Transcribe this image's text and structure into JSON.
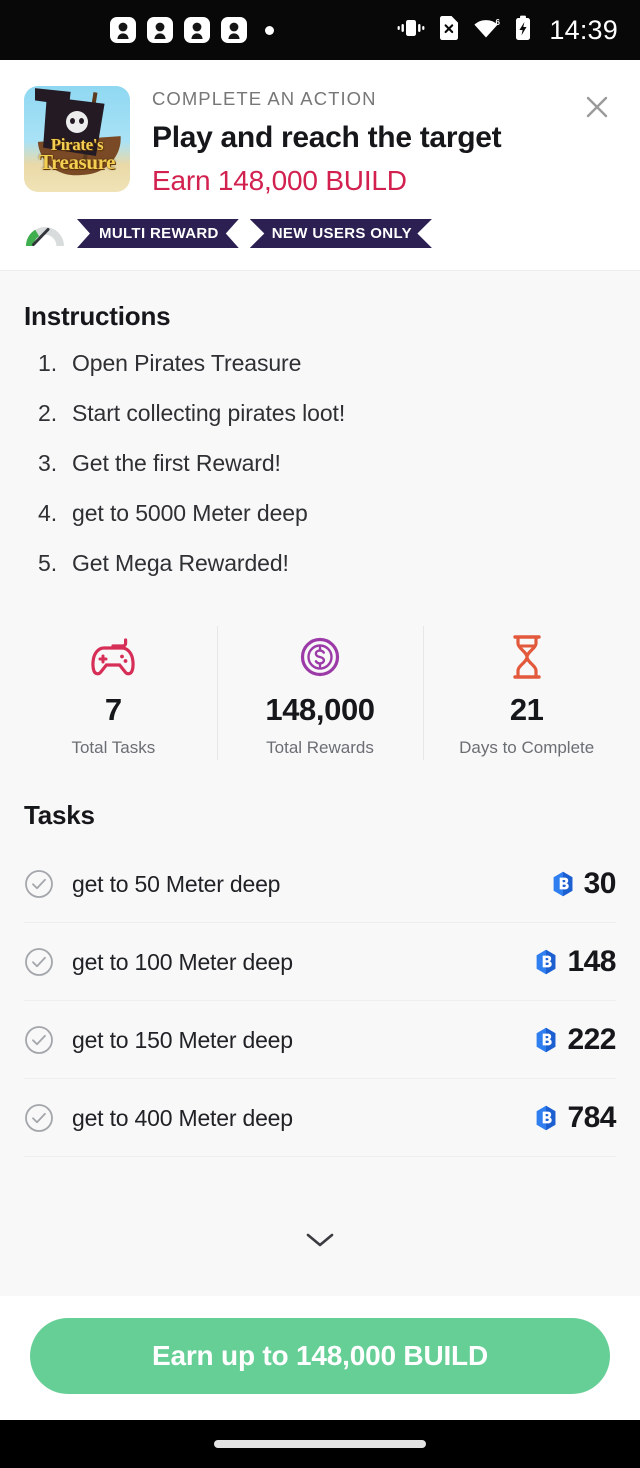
{
  "status_bar": {
    "time": "14:39",
    "notification_count": 4,
    "icons": [
      "notification-icon",
      "notification-icon",
      "notification-icon",
      "notification-icon",
      "notification-dot",
      "vibrate-icon",
      "no-sim-icon",
      "wifi-icon",
      "battery-charging-icon"
    ],
    "wifi_label": "6"
  },
  "offer": {
    "kicker": "COMPLETE AN ACTION",
    "title": "Play and reach the target",
    "reward_text": "Earn 148,000 BUILD",
    "reward_color": "#d2204f",
    "app_icon_title_line1": "Pirate's",
    "app_icon_title_line2": "Treasure",
    "close_label": "✕",
    "badges": [
      {
        "label": "MULTI REWARD"
      },
      {
        "label": "NEW USERS ONLY"
      }
    ],
    "difficulty_icon": "gauge-icon",
    "badge_color": "#2c1f51"
  },
  "instructions": {
    "heading": "Instructions",
    "steps": [
      "Open Pirates Treasure",
      "Start collecting pirates loot!",
      "Get the first Reward!",
      "get to 5000 Meter deep",
      "Get Mega Rewarded!"
    ]
  },
  "stats": [
    {
      "icon": "gamepad-icon",
      "value": "7",
      "label": "Total Tasks",
      "color": "#d62e56"
    },
    {
      "icon": "dollar-coin-icon",
      "value": "148,000",
      "label": "Total Rewards",
      "color": "#9c3ba8"
    },
    {
      "icon": "hourglass-icon",
      "value": "21",
      "label": "Days to Complete",
      "color": "#e2593c"
    }
  ],
  "tasks": {
    "heading": "Tasks",
    "token_icon": "build-token-icon",
    "token_color": "#1f6fe0",
    "items": [
      {
        "name": "get to 50 Meter deep",
        "amount": "30"
      },
      {
        "name": "get to 100 Meter deep",
        "amount": "148"
      },
      {
        "name": "get to 150 Meter deep",
        "amount": "222"
      },
      {
        "name": "get to 400 Meter deep",
        "amount": "784"
      }
    ],
    "expand_icon": "chevron-down-icon"
  },
  "cta": {
    "label": "Earn up to 148,000 BUILD",
    "color": "#66cf96"
  }
}
